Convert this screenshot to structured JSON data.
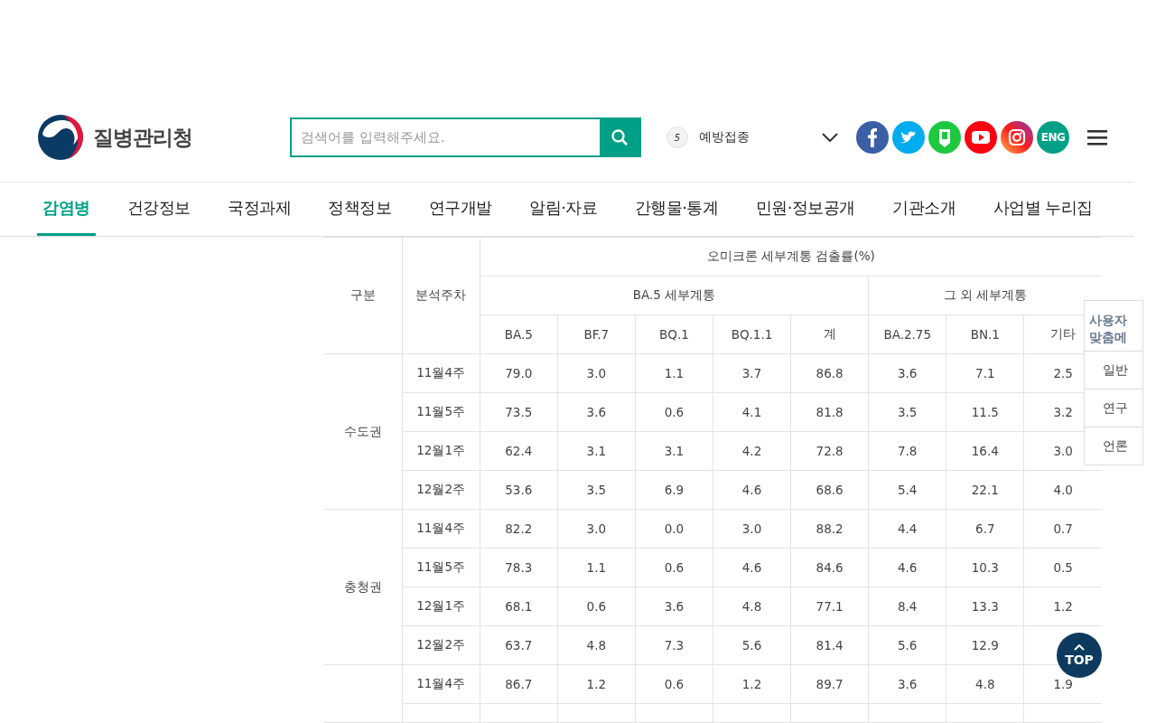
{
  "header": {
    "org_name": "질병관리청",
    "search": {
      "placeholder": "검색어를 입력해주세요."
    },
    "ranking": {
      "rank": "5",
      "keyword": "예방접종"
    },
    "social": [
      {
        "kind": "facebook"
      },
      {
        "kind": "twitter"
      },
      {
        "kind": "blog"
      },
      {
        "kind": "youtube"
      },
      {
        "kind": "instagram"
      },
      {
        "kind": "text",
        "label": "ENG"
      }
    ]
  },
  "nav": [
    {
      "label": "감염병",
      "selected": true
    },
    {
      "label": "건강정보",
      "selected": false
    },
    {
      "label": "국정과제",
      "selected": false
    },
    {
      "label": "정책정보",
      "selected": false
    },
    {
      "label": "연구개발",
      "selected": false
    },
    {
      "label": "알림·자료",
      "selected": false
    },
    {
      "label": "간행물·통계",
      "selected": false
    },
    {
      "label": "민원·정보공개",
      "selected": false
    },
    {
      "label": "기관소개",
      "selected": false
    },
    {
      "label": "사업별 누리집",
      "selected": false
    }
  ],
  "table": {
    "region_header": "구분",
    "week_header": "분석주차",
    "group_header": "오미크론 세부계통 검출률(%)",
    "subgroups": [
      {
        "label": "BA.5 세부계통",
        "columns": [
          "BA.5",
          "BF.7",
          "BQ.1",
          "BQ.1.1",
          "계"
        ]
      },
      {
        "label": "그 외 세부계통",
        "columns": [
          "BA.2.75",
          "BN.1",
          "기타"
        ]
      }
    ],
    "regions": [
      {
        "name": "수도권",
        "rows": [
          {
            "week": "11월4주",
            "values": [
              "79.0",
              "3.0",
              "1.1",
              "3.7",
              "86.8",
              "3.6",
              "7.1",
              "2.5"
            ]
          },
          {
            "week": "11월5주",
            "values": [
              "73.5",
              "3.6",
              "0.6",
              "4.1",
              "81.8",
              "3.5",
              "11.5",
              "3.2"
            ]
          },
          {
            "week": "12월1주",
            "values": [
              "62.4",
              "3.1",
              "3.1",
              "4.2",
              "72.8",
              "7.8",
              "16.4",
              "3.0"
            ]
          },
          {
            "week": "12월2주",
            "values": [
              "53.6",
              "3.5",
              "6.9",
              "4.6",
              "68.6",
              "5.4",
              "22.1",
              "4.0"
            ]
          }
        ]
      },
      {
        "name": "충청권",
        "rows": [
          {
            "week": "11월4주",
            "values": [
              "82.2",
              "3.0",
              "0.0",
              "3.0",
              "88.2",
              "4.4",
              "6.7",
              "0.7"
            ]
          },
          {
            "week": "11월5주",
            "values": [
              "78.3",
              "1.1",
              "0.6",
              "4.6",
              "84.6",
              "4.6",
              "10.3",
              "0.5"
            ]
          },
          {
            "week": "12월1주",
            "values": [
              "68.1",
              "0.6",
              "3.6",
              "4.8",
              "77.1",
              "8.4",
              "13.3",
              "1.2"
            ]
          },
          {
            "week": "12월2주",
            "values": [
              "63.7",
              "4.8",
              "7.3",
              "5.6",
              "81.4",
              "5.6",
              "12.9"
            ]
          }
        ]
      },
      {
        "rows": [
          {
            "week": "11월4주",
            "values": [
              "86.7",
              "1.2",
              "0.6",
              "1.2",
              "89.7",
              "3.6",
              "4.8",
              "1.9"
            ]
          }
        ]
      }
    ]
  },
  "side_menu": {
    "title": [
      "사용자",
      "맞춤메"
    ],
    "items": [
      "일반",
      "연구",
      "언론"
    ]
  },
  "top_button": {
    "label": "TOP"
  }
}
